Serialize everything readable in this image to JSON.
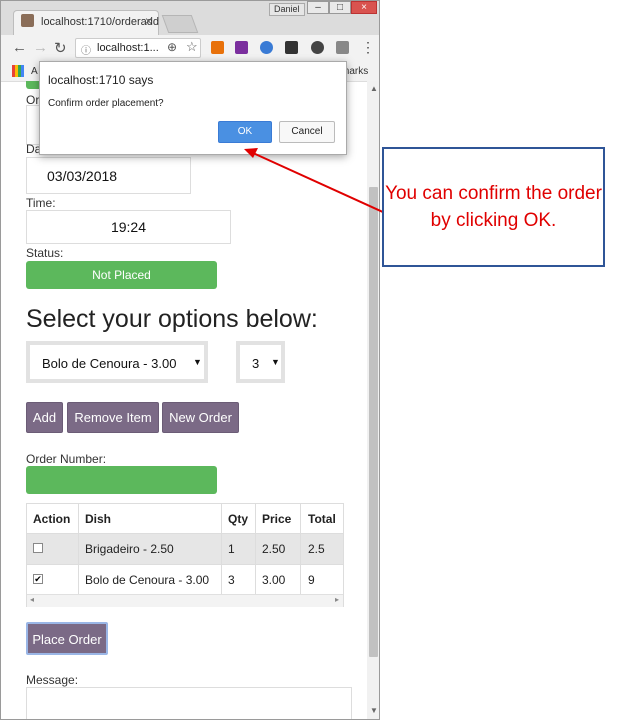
{
  "browser": {
    "tab_title": "localhost:1710/orderadd",
    "user": "Daniel",
    "url": "localhost:1...",
    "bookmarks_left": "A",
    "bookmarks_right": "marks"
  },
  "page": {
    "order_label_partial": "Or",
    "date_label_partial": "Da",
    "date_value": "03/03/2018",
    "time_label": "Time:",
    "time_value": "19:24",
    "status_label": "Status:",
    "status_value": "Not Placed",
    "options_heading": "Select your options below:",
    "dish_select": "Bolo de Cenoura - 3.00",
    "qty_select": "3",
    "buttons": {
      "add": "Add",
      "remove": "Remove Item",
      "new_order": "New Order",
      "place_order": "Place Order"
    },
    "order_number_label": "Order Number:",
    "message_label": "Message:",
    "table": {
      "headers": [
        "Action",
        "Dish",
        "Qty",
        "Price",
        "Total"
      ],
      "rows": [
        {
          "checked": false,
          "dish": "Brigadeiro - 2.50",
          "qty": "1",
          "price": "2.50",
          "total": "2.5"
        },
        {
          "checked": true,
          "dish": "Bolo de Cenoura - 3.00",
          "qty": "3",
          "price": "3.00",
          "total": "9"
        }
      ]
    }
  },
  "dialog": {
    "title": "localhost:1710 says",
    "message": "Confirm order placement?",
    "ok": "OK",
    "cancel": "Cancel"
  },
  "annotation": {
    "text": "You can confirm the order by clicking OK.",
    "color": "#e00000",
    "border_color": "#2f5597"
  }
}
